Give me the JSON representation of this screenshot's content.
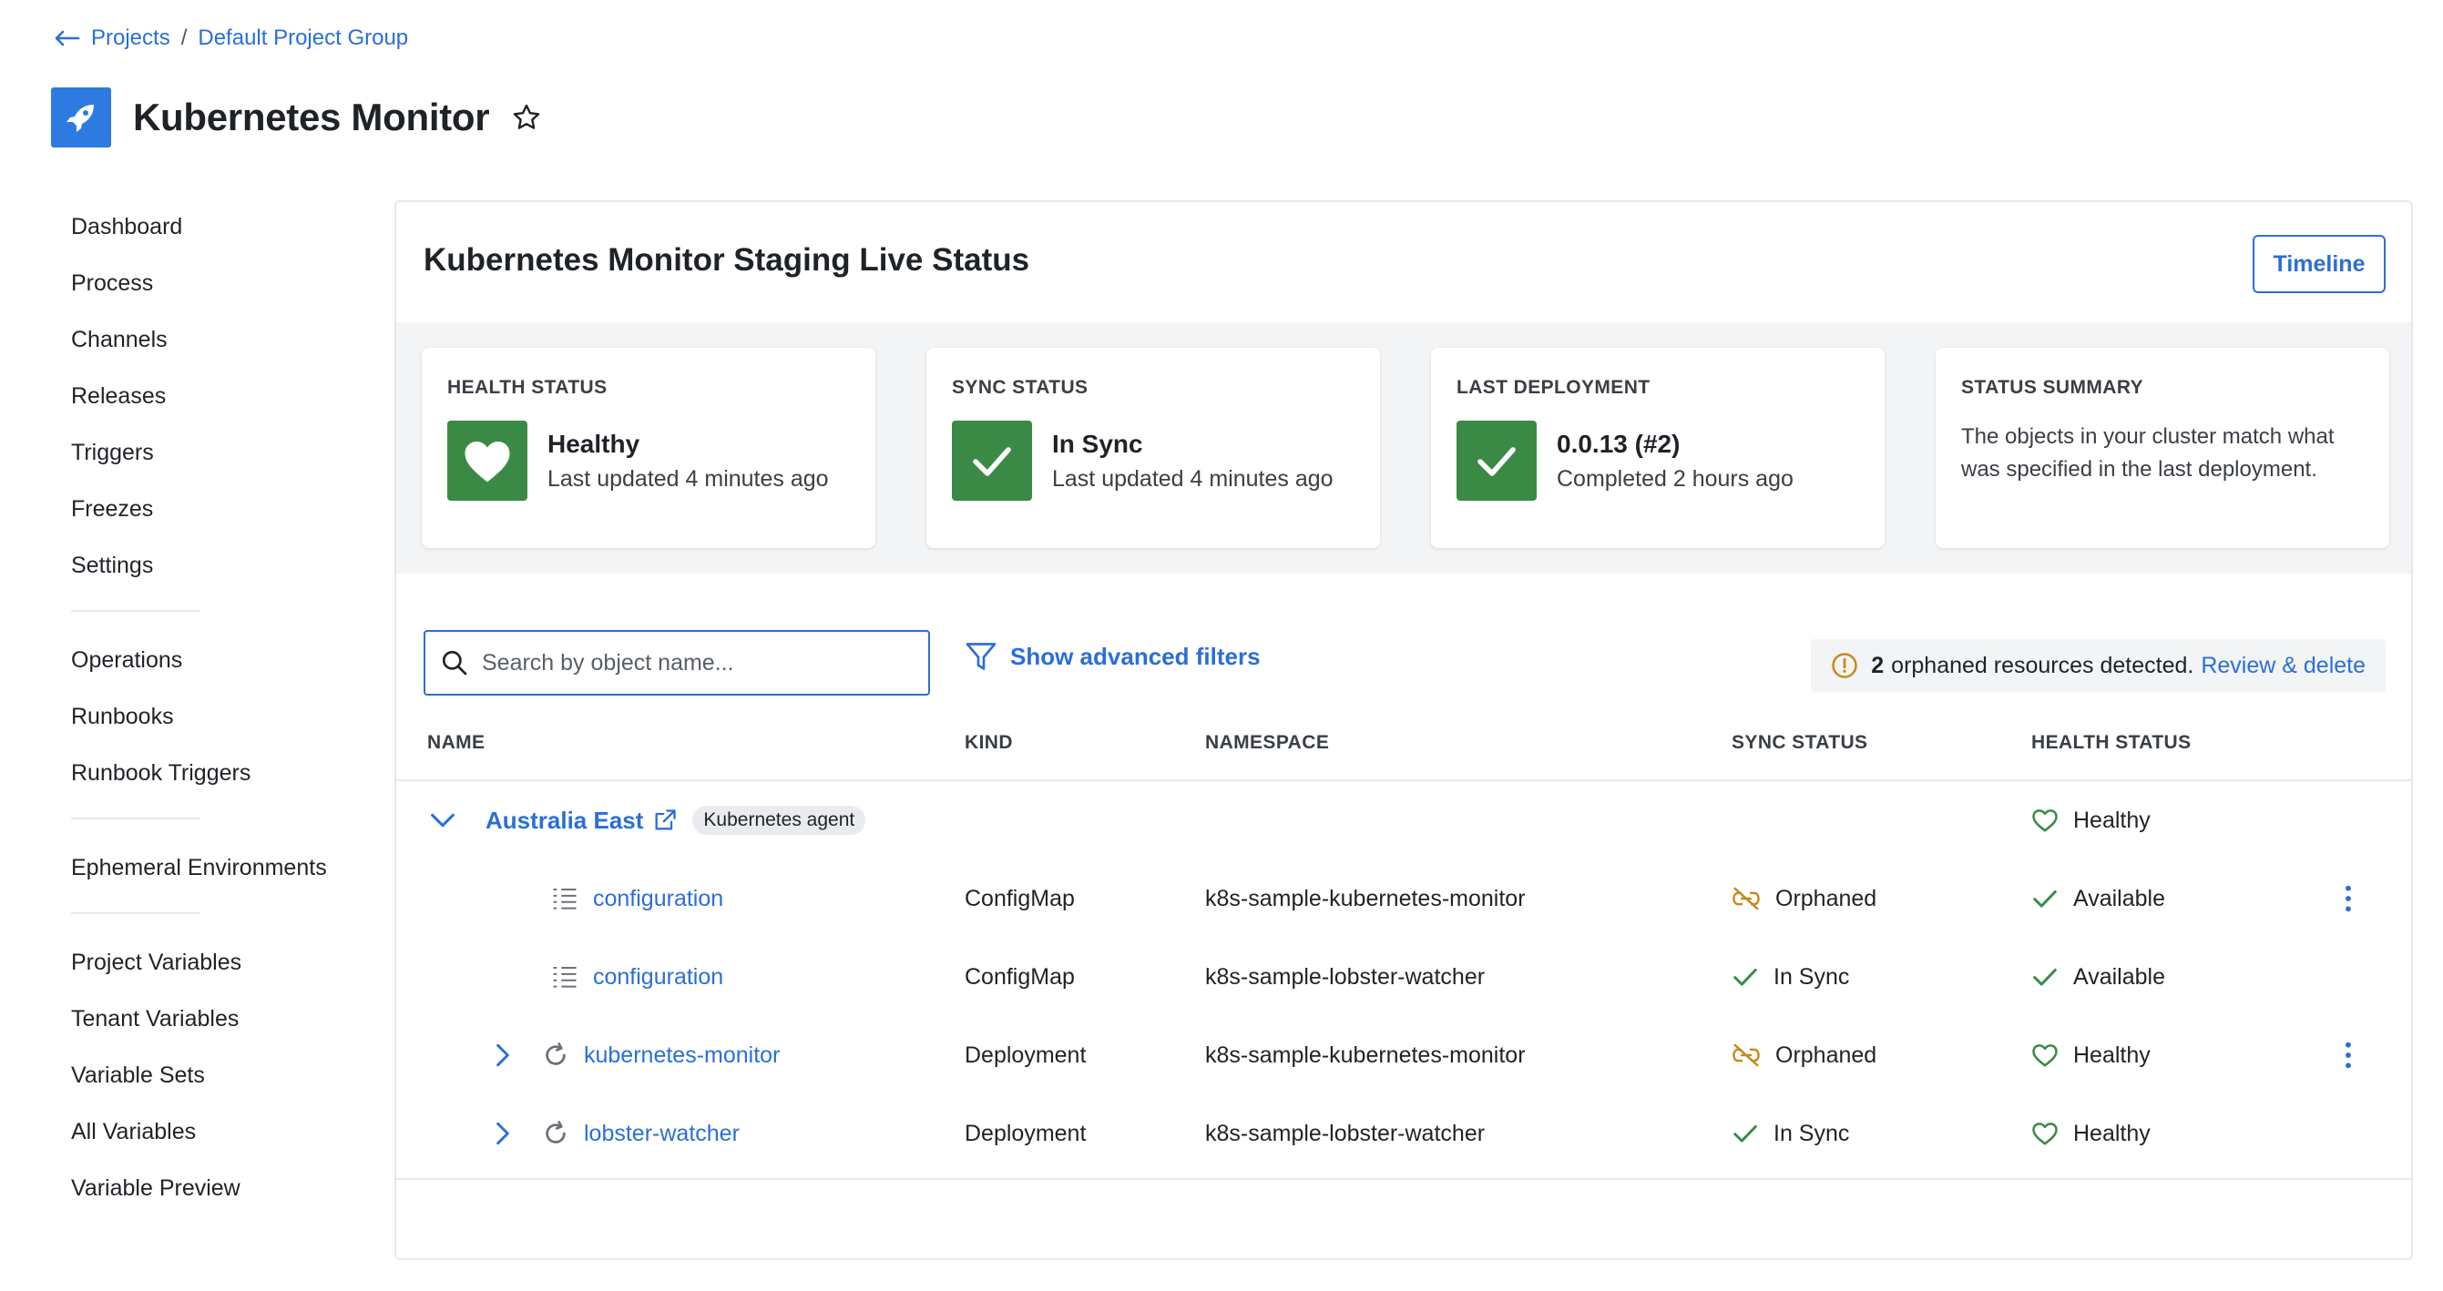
{
  "breadcrumb": {
    "projects": "Projects",
    "separator": "/",
    "group": "Default Project Group"
  },
  "project": {
    "title": "Kubernetes Monitor",
    "logo_icon": "rocket-icon",
    "favorite_icon": "star-outline-icon"
  },
  "sidebar": {
    "section1": [
      "Dashboard",
      "Process",
      "Channels",
      "Releases",
      "Triggers",
      "Freezes",
      "Settings"
    ],
    "section2": [
      "Operations",
      "Runbooks",
      "Runbook Triggers"
    ],
    "section3": [
      "Ephemeral Environments"
    ],
    "section4": [
      "Project Variables",
      "Tenant Variables",
      "Variable Sets",
      "All Variables",
      "Variable Preview"
    ]
  },
  "panel": {
    "title": "Kubernetes Monitor Staging Live Status",
    "timeline_button": "Timeline"
  },
  "status_cards": {
    "health": {
      "label": "HEALTH STATUS",
      "value": "Healthy",
      "sub": "Last updated 4 minutes ago",
      "icon": "heart-icon"
    },
    "sync": {
      "label": "SYNC STATUS",
      "value": "In Sync",
      "sub": "Last updated 4 minutes ago",
      "icon": "check-icon"
    },
    "deployment": {
      "label": "LAST DEPLOYMENT",
      "value": "0.0.13 (#2)",
      "sub": "Completed 2 hours ago",
      "icon": "check-icon"
    },
    "summary": {
      "label": "STATUS SUMMARY",
      "text": "The objects in your cluster match what was specified in the last deployment."
    }
  },
  "filters": {
    "search_placeholder": "Search by object name...",
    "advanced_label": "Show advanced filters",
    "orphan_count": "2",
    "orphan_text": "orphaned resources detected.",
    "orphan_link": "Review & delete"
  },
  "table": {
    "headers": {
      "name": "NAME",
      "kind": "KIND",
      "namespace": "NAMESPACE",
      "sync": "SYNC STATUS",
      "health": "HEALTH STATUS"
    },
    "group": {
      "name": "Australia East",
      "badge": "Kubernetes agent",
      "health": "Healthy"
    },
    "rows": [
      {
        "name": "configuration",
        "kind": "ConfigMap",
        "namespace": "k8s-sample-kubernetes-monitor",
        "sync": "Orphaned",
        "health": "Available"
      },
      {
        "name": "configuration",
        "kind": "ConfigMap",
        "namespace": "k8s-sample-lobster-watcher",
        "sync": "In Sync",
        "health": "Available"
      },
      {
        "name": "kubernetes-monitor",
        "kind": "Deployment",
        "namespace": "k8s-sample-kubernetes-monitor",
        "sync": "Orphaned",
        "health": "Healthy"
      },
      {
        "name": "lobster-watcher",
        "kind": "Deployment",
        "namespace": "k8s-sample-lobster-watcher",
        "sync": "In Sync",
        "health": "Healthy"
      }
    ]
  },
  "colors": {
    "accent": "#2a6fd6",
    "success": "#3a8a46",
    "warning": "#c98a1a",
    "logo_bg": "#2d7be0"
  }
}
